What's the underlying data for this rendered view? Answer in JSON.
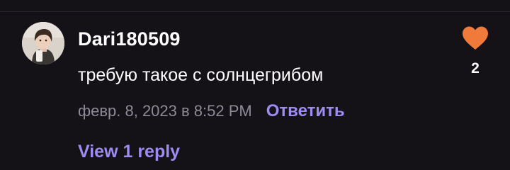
{
  "comment": {
    "username": "Dari180509",
    "text": "требую такое с солнцегрибом",
    "timestamp": "февр. 8, 2023 в 8:52 PM",
    "reply_label": "Ответить",
    "view_replies_label": "View 1 reply",
    "like_count": "2",
    "avatar_icon": "user-avatar-photo"
  },
  "colors": {
    "background": "#141117",
    "accent": "#9f8cf2",
    "heart": "#f07a3a",
    "muted_text": "#8e8a96",
    "primary_text": "#ffffff"
  }
}
